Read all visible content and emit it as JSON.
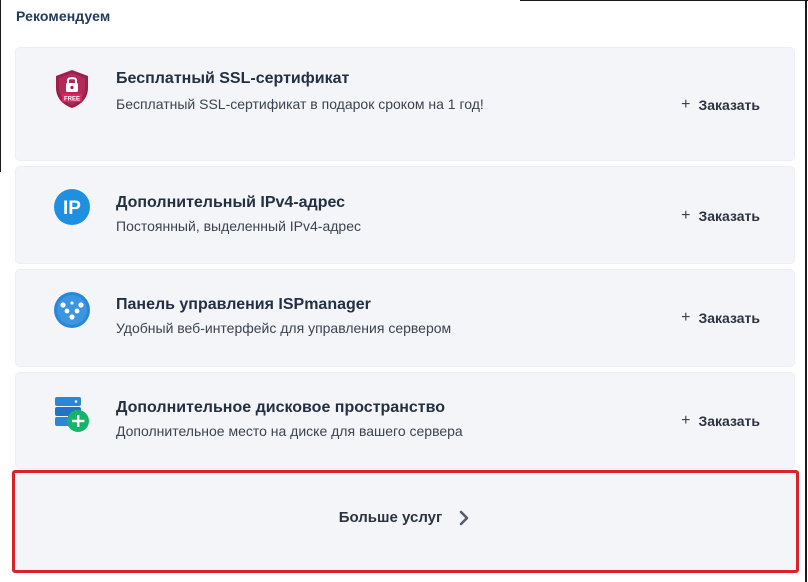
{
  "section": {
    "title": "Рекомендуем"
  },
  "services": [
    {
      "title": "Бесплатный SSL-сертификат",
      "description": "Бесплатный SSL-сертификат в подарок сроком на 1 год!",
      "icon": "ssl-free-shield-icon",
      "badge": "FREE",
      "action_label": "Заказать"
    },
    {
      "title": "Дополнительный IPv4-адрес",
      "description": "Постоянный, выделенный IPv4-адрес",
      "icon": "ip-icon",
      "badge": "IP",
      "action_label": "Заказать"
    },
    {
      "title": "Панель управления ISPmanager",
      "description": "Удобный веб-интерфейс для управления сервером",
      "icon": "ispmanager-icon",
      "action_label": "Заказать"
    },
    {
      "title": "Дополнительное дисковое пространство",
      "description": "Дополнительное место на диске для вашего сервера",
      "icon": "disk-add-icon",
      "action_label": "Заказать"
    }
  ],
  "more": {
    "label": "Больше услуг"
  },
  "colors": {
    "card_bg": "#f4f5f9",
    "highlight_border": "#d8232a",
    "ip_blue": "#1f8fe0",
    "ssl_maroon": "#9c1f4a"
  }
}
